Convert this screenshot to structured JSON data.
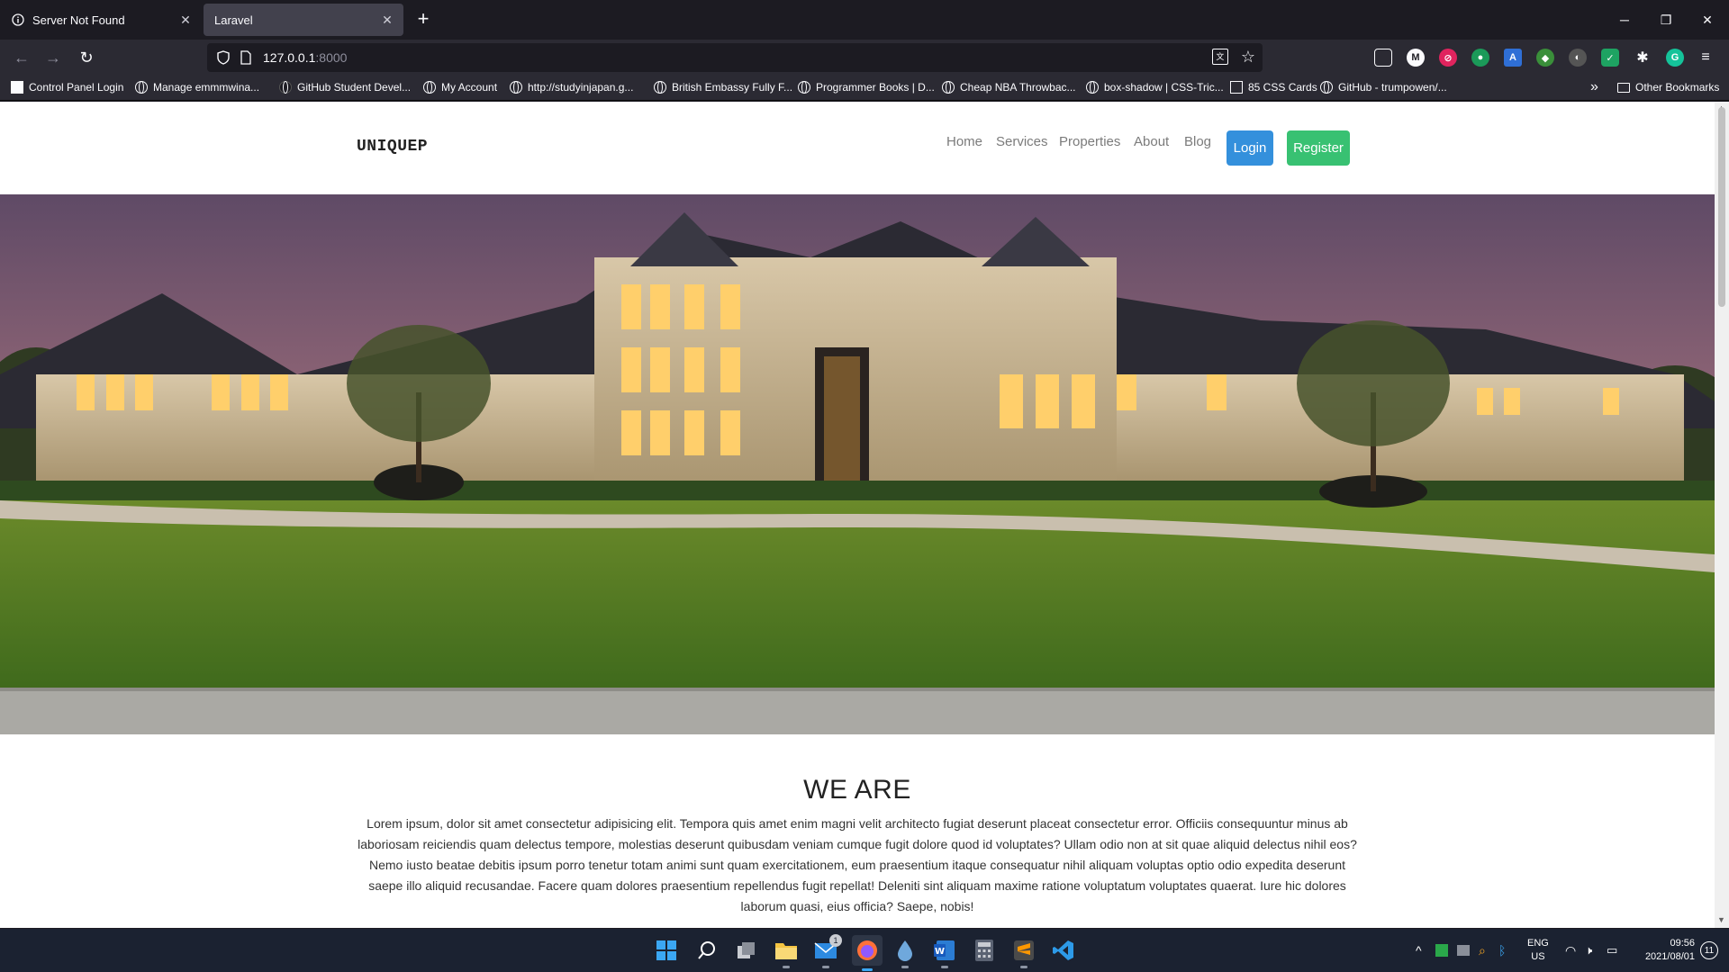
{
  "tabs": [
    {
      "title": "Server Not Found",
      "icon": "info-icon",
      "active": false
    },
    {
      "title": "Laravel",
      "icon": "none",
      "active": true
    }
  ],
  "url": {
    "host": "127.0.0.1",
    "port": ":8000"
  },
  "bookmarks": [
    "Control Panel Login",
    "Manage emmmwina...",
    "GitHub Student Devel...",
    "My Account",
    "http://studyinjapan.g...",
    "British Embassy Fully F...",
    "Programmer Books | D...",
    "Cheap NBA Throwbac...",
    "box-shadow | CSS-Tric...",
    "85 CSS Cards",
    "GitHub - trumpowen/..."
  ],
  "bookmarks_other": "Other Bookmarks",
  "site": {
    "brand": "UNIQUEP",
    "nav": [
      "Home",
      "Services",
      "Properties",
      "About",
      "Blog"
    ],
    "login": "Login",
    "register": "Register",
    "section_title": "WE ARE",
    "section_text": "Lorem ipsum, dolor sit amet consectetur adipisicing elit. Tempora quis amet enim magni velit architecto fugiat deserunt placeat consectetur error. Officiis consequuntur minus ab laboriosam reiciendis quam delectus tempore, molestias deserunt quibusdam veniam cumque fugit dolore quod id voluptates? Ullam odio non at sit quae aliquid delectus nihil eos? Nemo iusto beatae debitis ipsum porro tenetur totam animi sunt quam exercitationem, eum praesentium itaque consequatur nihil aliquam voluptas optio odio expedita deserunt saepe illo aliquid recusandae. Facere quam dolores praesentium repellendus fugit repellat! Deleniti sint aliquam maxime ratione voluptatum voluptates quaerat. Iure hic dolores laborum quasi, eius officia? Saepe, nobis!"
  },
  "tray": {
    "lang_top": "ENG",
    "lang_bottom": "US",
    "time": "09:56",
    "date": "2021/08/01",
    "notifications": "11",
    "mail_badge": "1"
  }
}
